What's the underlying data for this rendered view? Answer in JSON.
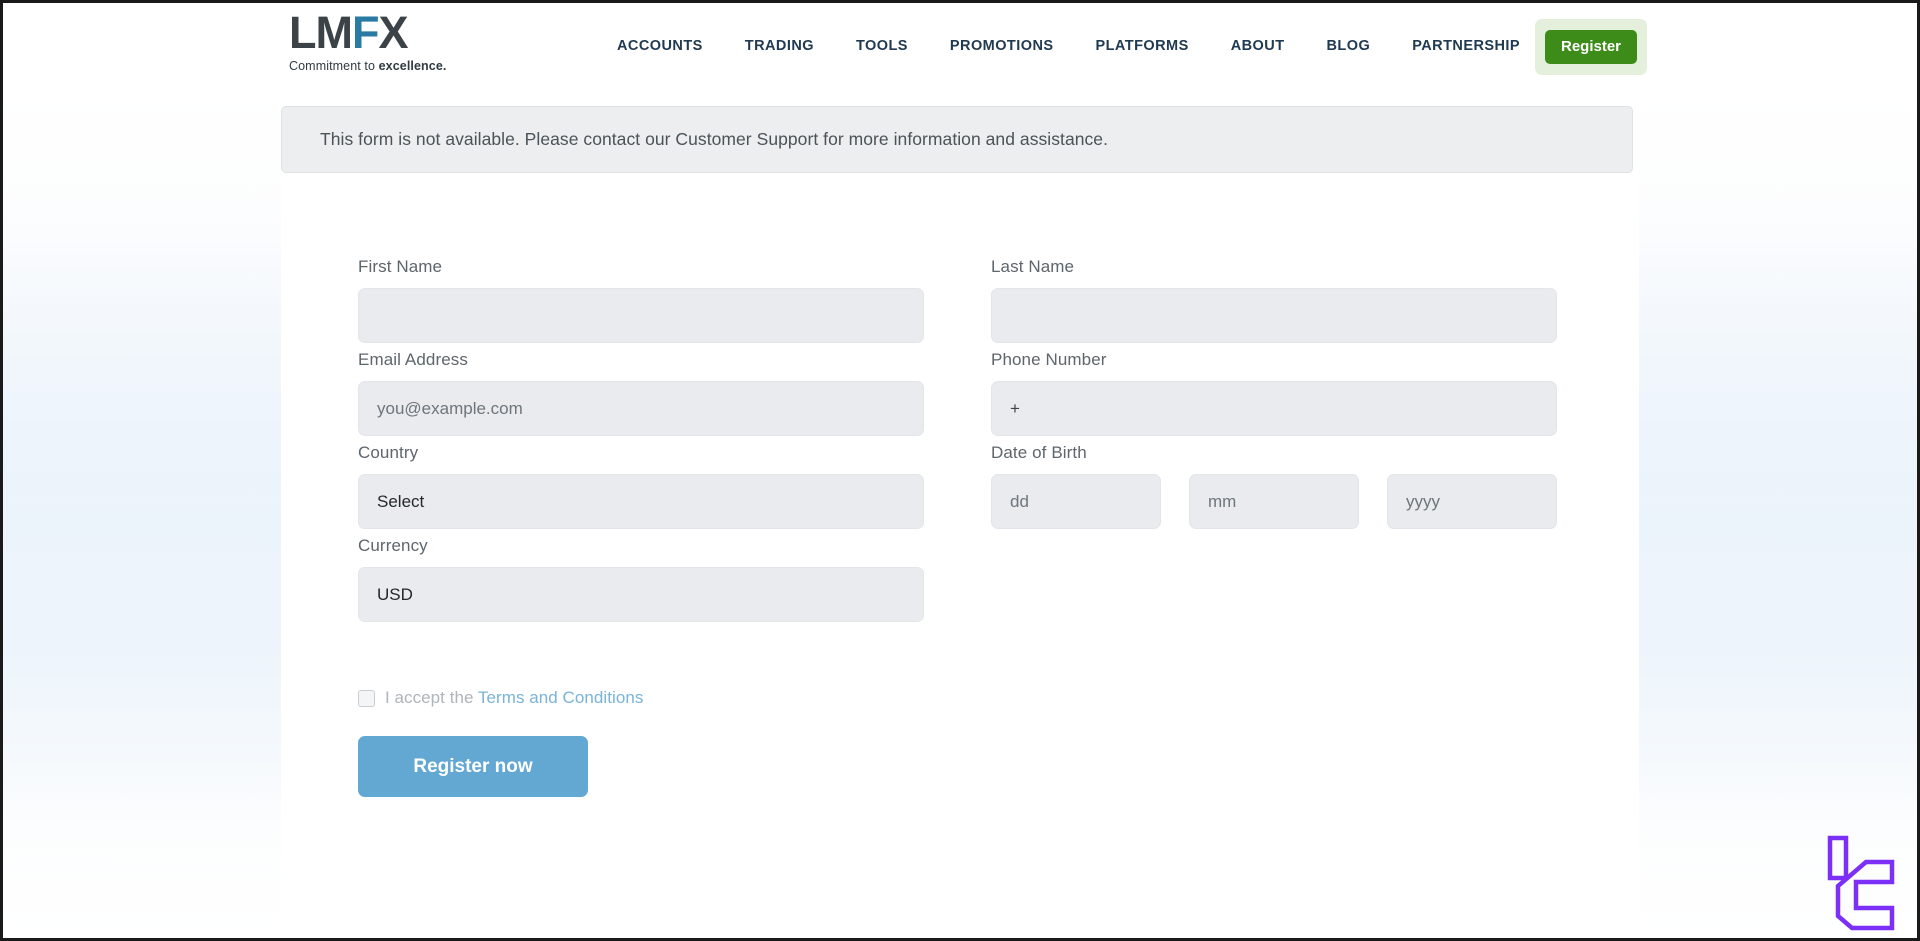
{
  "header": {
    "logo": {
      "text_left": "LM",
      "text_f": "F",
      "text_right": "X",
      "tagline_prefix": "Commitment to ",
      "tagline_bold": "excellence."
    },
    "nav": [
      {
        "label": "ACCOUNTS"
      },
      {
        "label": "TRADING"
      },
      {
        "label": "TOOLS"
      },
      {
        "label": "PROMOTIONS"
      },
      {
        "label": "PLATFORMS"
      },
      {
        "label": "ABOUT"
      },
      {
        "label": "BLOG"
      },
      {
        "label": "PARTNERSHIP"
      }
    ],
    "register_button": "Register",
    "register_button_color": "#3d8b18",
    "register_halo_color": "#e4efdc"
  },
  "notice": {
    "message": "This form is not available. Please contact our Customer Support for more information and assistance.",
    "background_color": "#eceef0"
  },
  "form": {
    "first_name": {
      "label": "First Name",
      "value": "",
      "placeholder": ""
    },
    "last_name": {
      "label": "Last Name",
      "value": "",
      "placeholder": ""
    },
    "email": {
      "label": "Email Address",
      "value": "",
      "placeholder": "you@example.com"
    },
    "phone": {
      "label": "Phone Number",
      "value": "+",
      "placeholder": ""
    },
    "country": {
      "label": "Country",
      "selected": "Select",
      "options": [
        "Select"
      ]
    },
    "date_of_birth": {
      "label": "Date of Birth",
      "day": {
        "value": "",
        "placeholder": "dd"
      },
      "month": {
        "value": "",
        "placeholder": "mm"
      },
      "year": {
        "value": "",
        "placeholder": "yyyy"
      }
    },
    "currency": {
      "label": "Currency",
      "selected": "USD",
      "options": [
        "USD"
      ]
    },
    "terms": {
      "checked": false,
      "text_prefix": "I accept the ",
      "link_text": "Terms and Conditions",
      "link_color": "#79b4d8"
    },
    "submit_button": {
      "label": "Register now",
      "color": "#62a8d2"
    }
  },
  "watermark": {
    "name": "purple-bracket-logo",
    "color": "#7b2ff7"
  }
}
